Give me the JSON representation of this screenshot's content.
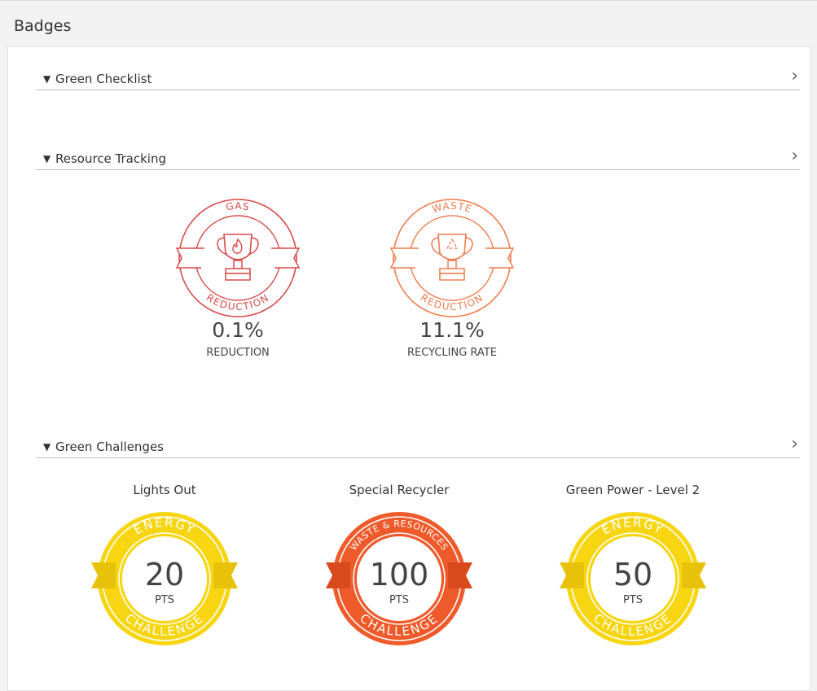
{
  "panel": {
    "title": "Badges"
  },
  "sections": {
    "checklist": {
      "label": "Green Checklist",
      "toggle": "▼",
      "chevron": "›"
    },
    "tracking": {
      "label": "Resource Tracking",
      "toggle": "▼",
      "chevron": "›"
    },
    "challenges": {
      "label": "Green Challenges",
      "toggle": "▼",
      "chevron": "›"
    }
  },
  "tracking_badges": [
    {
      "top_text": "GAS",
      "bottom_text": "REDUCTION",
      "value": "0.1%",
      "caption": "REDUCTION",
      "color": "#d84a4a",
      "icon": "flame-icon"
    },
    {
      "top_text": "WASTE",
      "bottom_text": "REDUCTION",
      "value": "11.1%",
      "caption": "RECYCLING RATE",
      "color": "#ef7c4d",
      "icon": "recycle-icon"
    }
  ],
  "challenge_badges": [
    {
      "title": "Lights Out",
      "category": "ENERGY",
      "points": "20",
      "unit": "PTS",
      "footer": "CHALLENGE",
      "color": "#f7d611",
      "dark": "#e8c20a"
    },
    {
      "title": "Special Recycler",
      "category": "WASTE & RESOURCES",
      "points": "100",
      "unit": "PTS",
      "footer": "CHALLENGE",
      "color": "#ef5a2a",
      "dark": "#d94a1c"
    },
    {
      "title": "Green Power - Level 2",
      "category": "ENERGY",
      "points": "50",
      "unit": "PTS",
      "footer": "CHALLENGE",
      "color": "#f7d611",
      "dark": "#e8c20a"
    }
  ]
}
